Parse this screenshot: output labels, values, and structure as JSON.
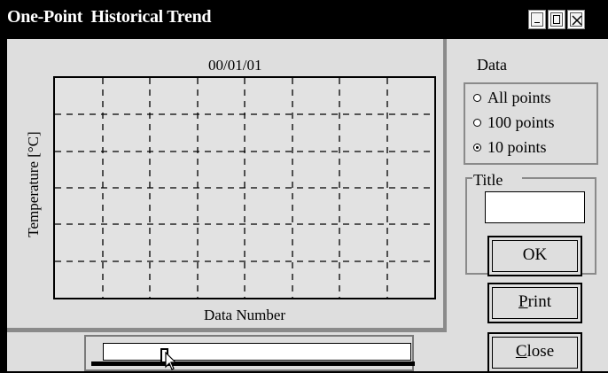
{
  "window": {
    "title": "One-Point  Historical Trend",
    "controls": [
      "minimize-icon",
      "maximize-icon",
      "close-icon"
    ]
  },
  "chart": {
    "date": "00/01/01",
    "ylabel": "Temperature [°C]",
    "xlabel": "Data Number",
    "grid": "dashed",
    "grid_columns": 8,
    "grid_rows": 6
  },
  "data_panel": {
    "label": "Data",
    "options": [
      {
        "label": "All points",
        "selected": false
      },
      {
        "label": "100 points",
        "selected": false
      },
      {
        "label": "10 points",
        "selected": true
      }
    ]
  },
  "title_panel": {
    "legend": "Title",
    "value": "",
    "ok_label": "OK"
  },
  "buttons": {
    "print_label_first": "P",
    "print_label_rest": "rint",
    "close_label_first": "C",
    "close_label_rest": "lose"
  },
  "scrollbar": {
    "position": 0.2
  },
  "colors": {
    "titlebar": "#000000",
    "title_text": "#ffffff",
    "panel": "#dedede",
    "frame": "#8a8a8a"
  }
}
